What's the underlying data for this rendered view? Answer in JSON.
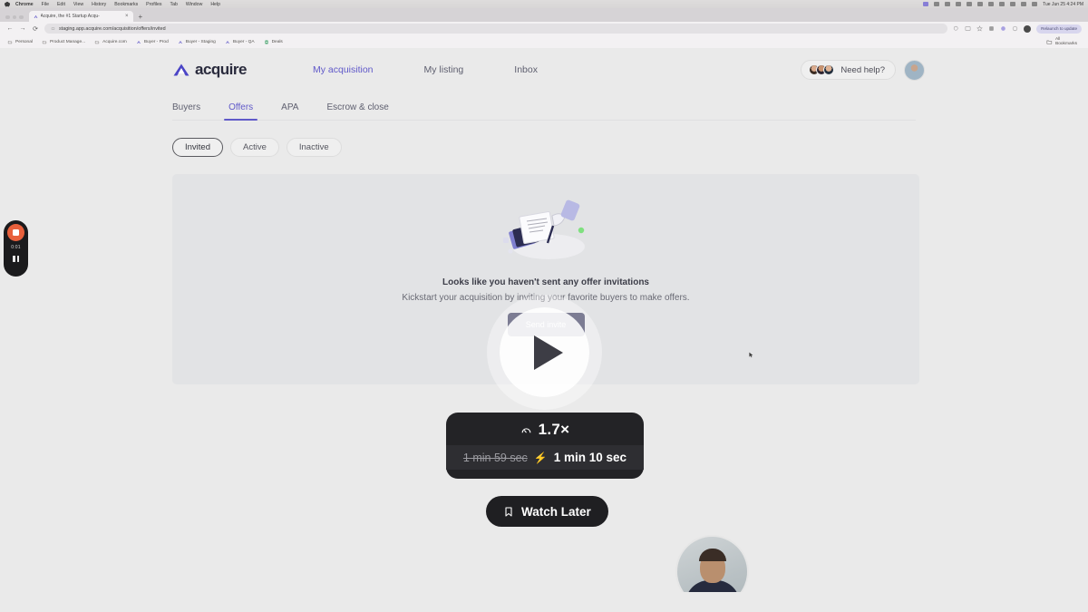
{
  "os": {
    "menubar": {
      "app": "Chrome",
      "items": [
        "File",
        "Edit",
        "View",
        "History",
        "Bookmarks",
        "Profiles",
        "Tab",
        "Window",
        "Help"
      ],
      "clock": "Tue Jun 25  4:24 PM"
    }
  },
  "browser": {
    "tab": {
      "title": "Acquire, the #1 Startup Acqu-",
      "close_label": "×"
    },
    "new_tab_label": "+",
    "nav": {
      "back": "←",
      "forward": "→",
      "reload": "⟳"
    },
    "omnibox": {
      "url": "staging.app.acquire.com/acquisition/offers/invited"
    },
    "relaunch_label": "Relaunch to update",
    "bookmarks": [
      "Personal",
      "Product Manage...",
      "Acquire.com",
      "Buyer - Prod",
      "Buyer - Staging",
      "Buyer - QA",
      "Deals"
    ],
    "all_bookmarks_label": "All Bookmarks"
  },
  "app": {
    "brand": "acquire",
    "nav": [
      {
        "label": "My acquisition",
        "active": true
      },
      {
        "label": "My listing",
        "active": false
      },
      {
        "label": "Inbox",
        "active": false
      }
    ],
    "help_label": "Need help?",
    "subnav": [
      {
        "label": "Buyers",
        "active": false
      },
      {
        "label": "Offers",
        "active": true
      },
      {
        "label": "APA",
        "active": false
      },
      {
        "label": "Escrow & close",
        "active": false
      }
    ],
    "filters": [
      {
        "label": "Invited",
        "selected": true
      },
      {
        "label": "Active",
        "selected": false
      },
      {
        "label": "Inactive",
        "selected": false
      }
    ],
    "empty_state": {
      "title": "Looks like you haven't sent any offer invitations",
      "subtitle": "Kickstart your acquisition by inviting your favorite buyers to make offers.",
      "button_label": "Send invite"
    }
  },
  "player": {
    "play_label": "Play",
    "speed_value": "1.7×",
    "original_duration": "1 min 59 sec",
    "adjusted_duration": "1 min 10 sec",
    "watch_later_label": "Watch Later"
  },
  "recorder": {
    "timer": "0:01",
    "stop_label": "Stop recording",
    "pause_label": "Pause recording"
  },
  "colors": {
    "brand_purple": "#6059c9",
    "brand_dark": "#2c2d52",
    "record_orange": "#e8603c",
    "page_bg": "#eaeaea",
    "card_bg": "#e2e3e5"
  }
}
